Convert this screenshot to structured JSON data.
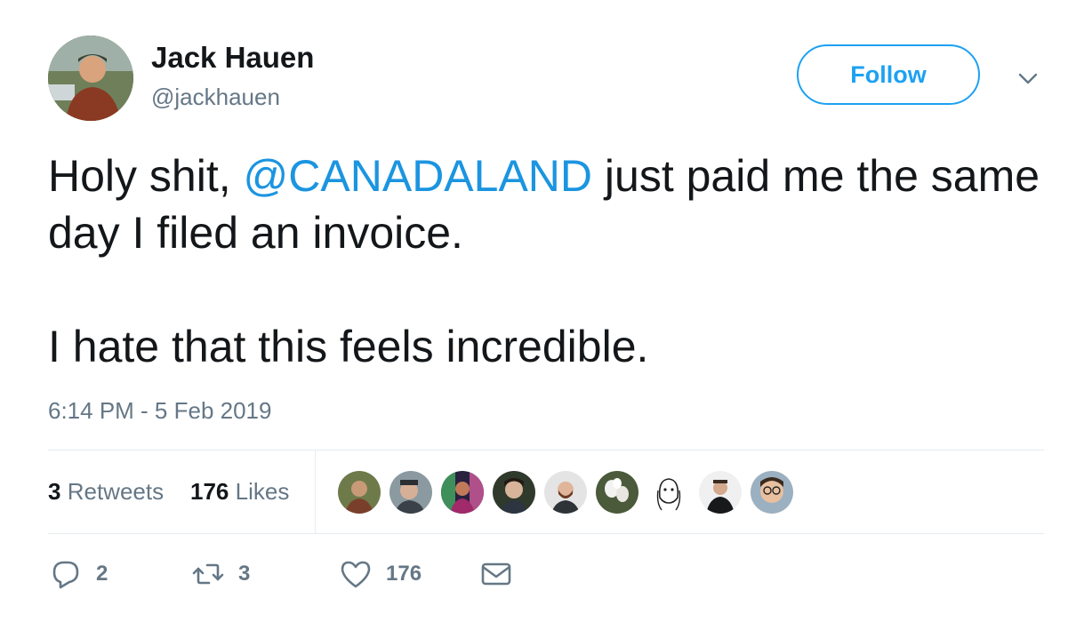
{
  "author": {
    "name": "Jack Hauen",
    "handle": "@jackhauen"
  },
  "follow_button_label": "Follow",
  "tweet": {
    "text_before": "Holy shit, ",
    "mention": "@CANADALAND",
    "text_after": " just paid me the same day I filed an invoice.\n\nI hate that this feels incredible.",
    "timestamp": "6:14 PM - 5 Feb 2019"
  },
  "stats": {
    "retweets_count": "3",
    "retweets_label": "Retweets",
    "likes_count": "176",
    "likes_label": "Likes"
  },
  "actions": {
    "reply_count": "2",
    "retweet_count": "3",
    "like_count": "176"
  },
  "colors": {
    "accent": "#1da1f2",
    "mention": "#1b95e0",
    "secondary_text": "#657786",
    "divider": "#e6ecf0"
  },
  "icons": [
    "reply-icon",
    "retweet-icon",
    "heart-icon",
    "envelope-icon",
    "chevron-down-icon"
  ]
}
